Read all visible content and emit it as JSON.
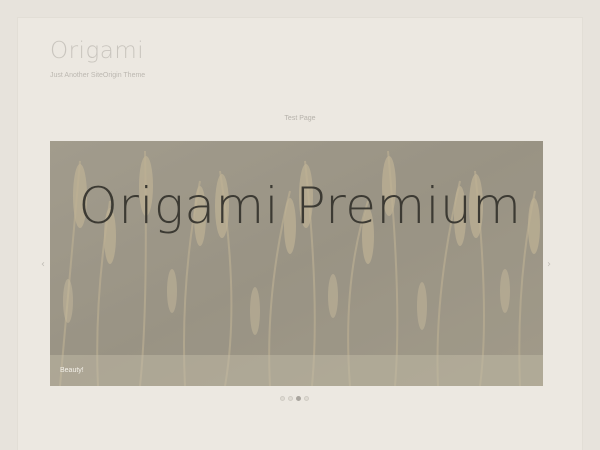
{
  "site": {
    "title": "Origami",
    "tagline": "Just Another SiteOrigin Theme"
  },
  "nav": {
    "items": [
      {
        "label": "Test Page"
      }
    ]
  },
  "slider": {
    "heading": "Origami Premium",
    "caption": "Beauty!",
    "prev_arrow": "‹",
    "next_arrow": "›",
    "dot_count": 4,
    "active_slide": 3
  },
  "colors": {
    "background": "#e7e3dc",
    "heading": "#3c3a33",
    "muted_text": "#c9c5be"
  }
}
